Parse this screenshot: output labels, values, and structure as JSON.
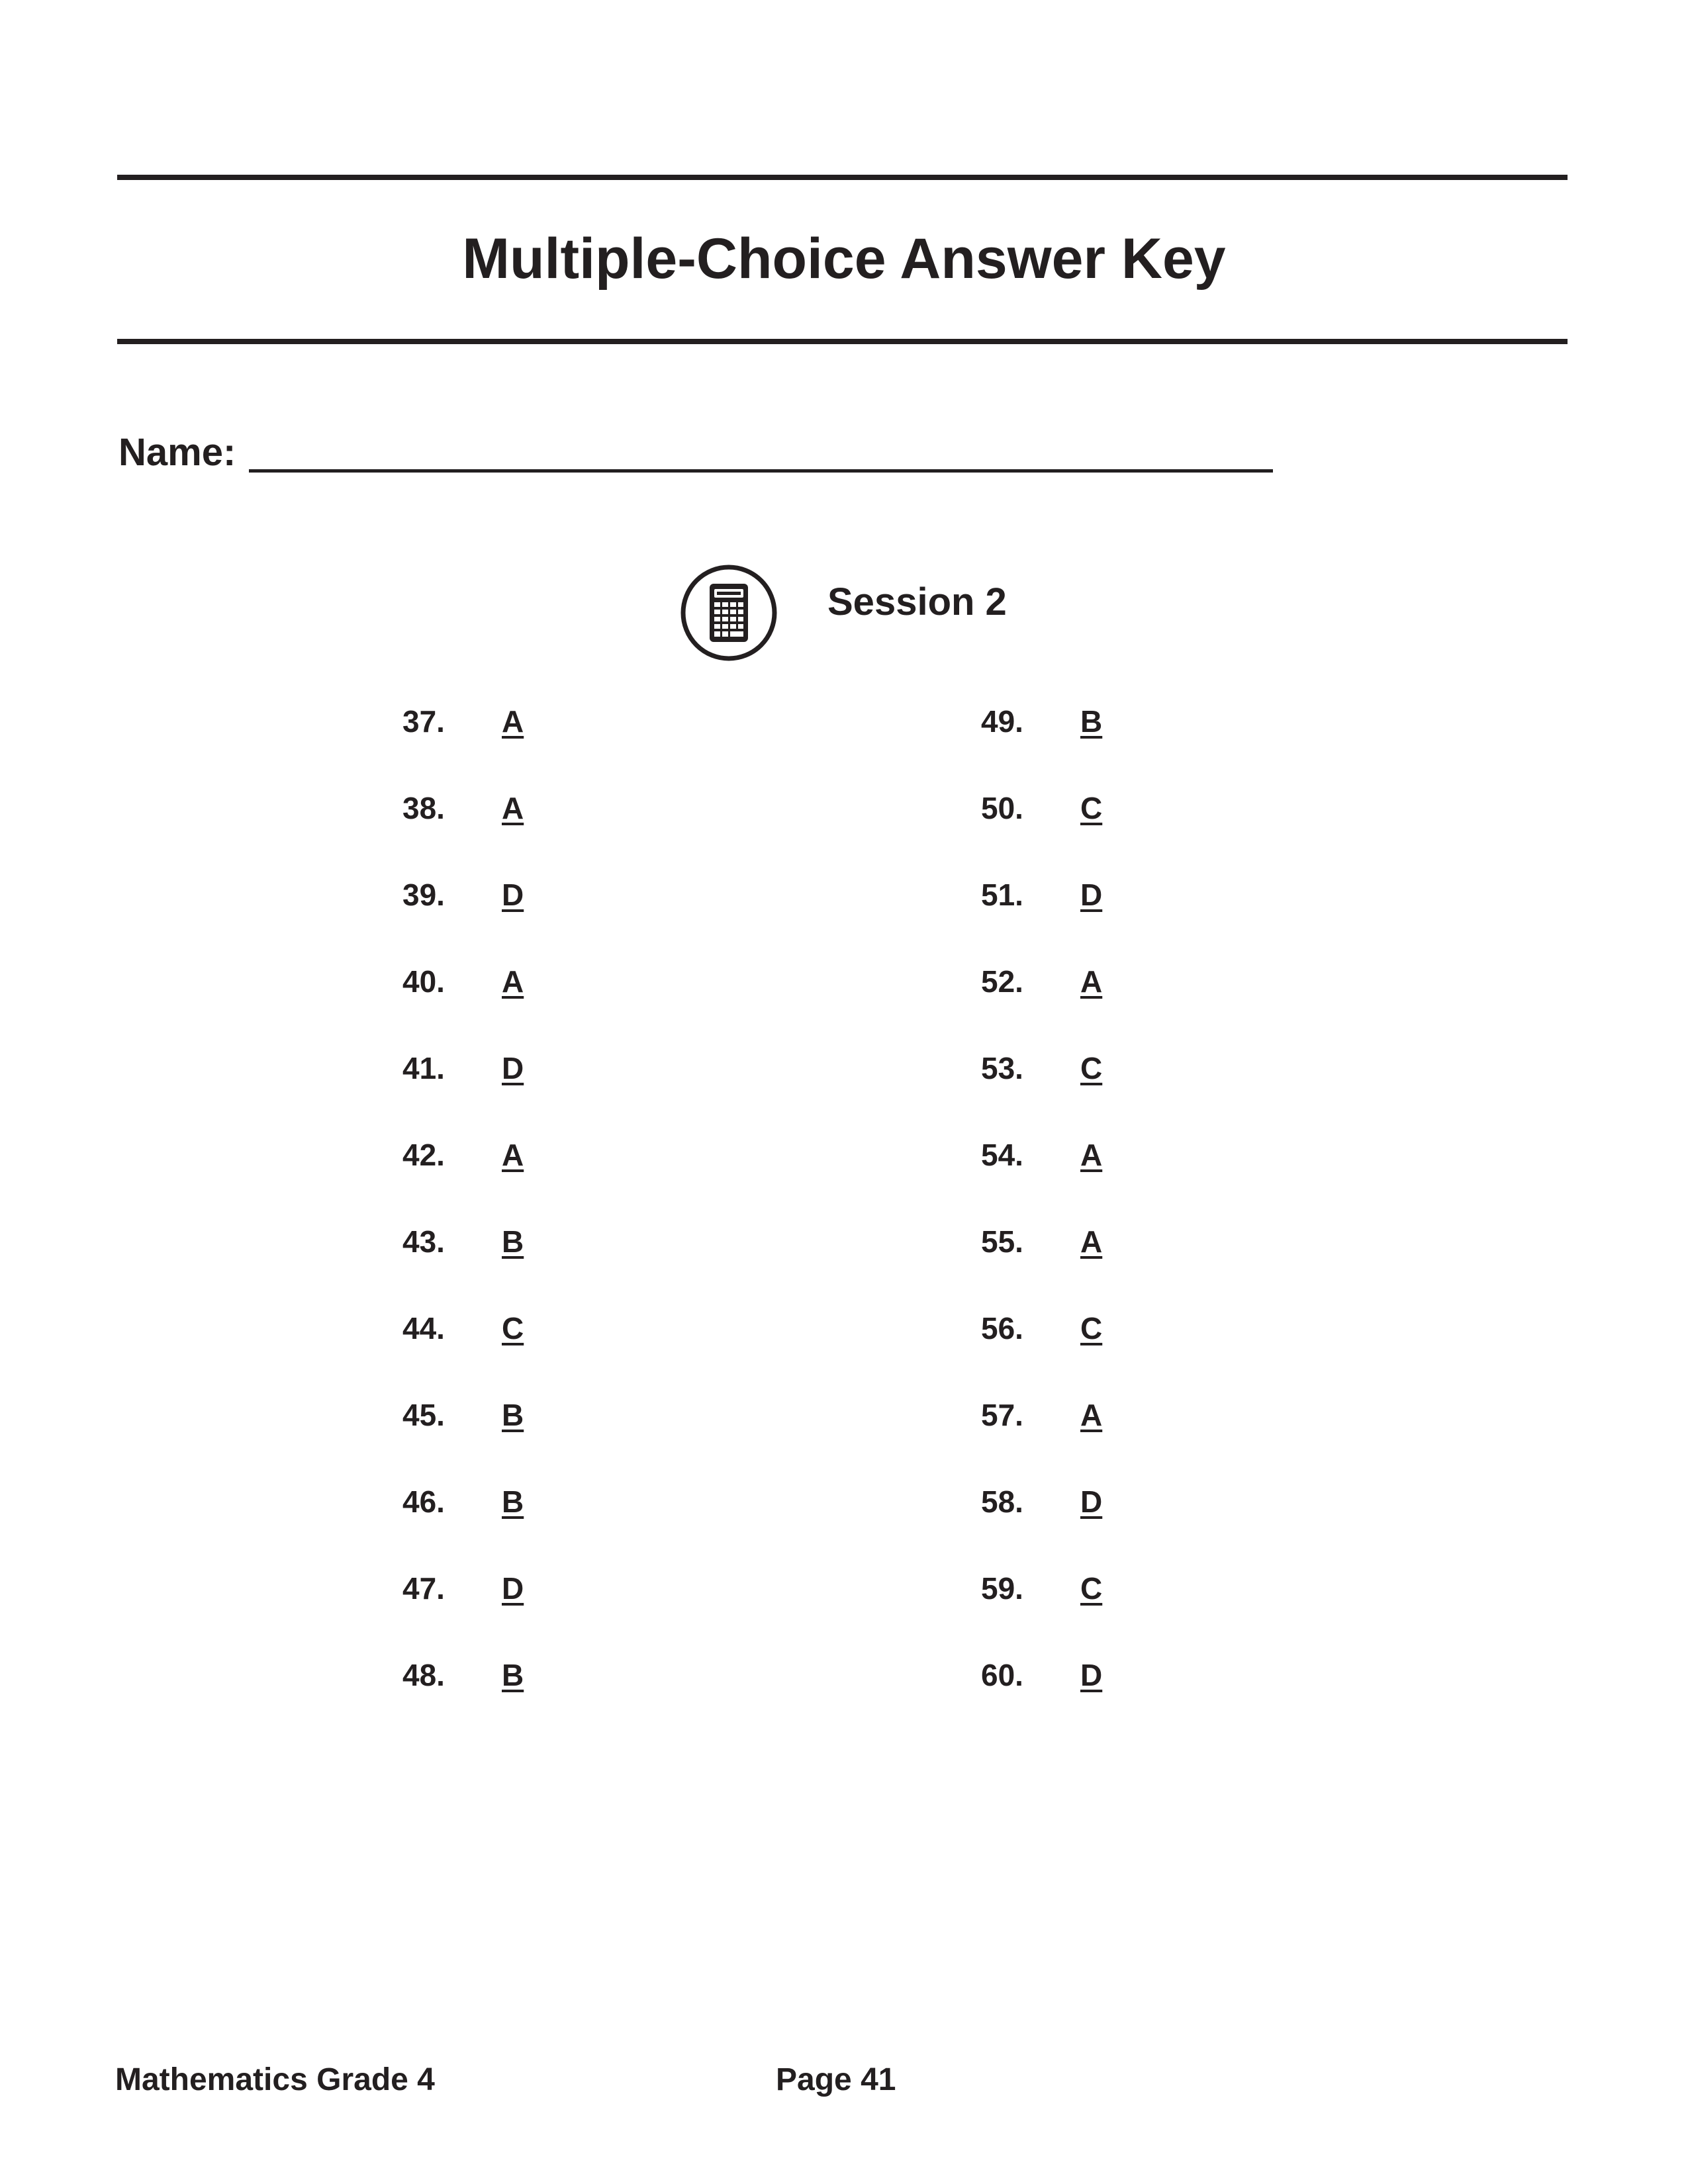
{
  "header": {
    "title": "Multiple-Choice Answer Key"
  },
  "name_field": {
    "label": "Name:"
  },
  "session": {
    "icon": "calculator-icon",
    "title": "Session 2"
  },
  "answers": {
    "left": [
      {
        "number": "37.",
        "answer": "A"
      },
      {
        "number": "38.",
        "answer": "A"
      },
      {
        "number": "39.",
        "answer": "D"
      },
      {
        "number": "40.",
        "answer": "A"
      },
      {
        "number": "41.",
        "answer": "D"
      },
      {
        "number": "42.",
        "answer": "A"
      },
      {
        "number": "43.",
        "answer": "B"
      },
      {
        "number": "44.",
        "answer": "C"
      },
      {
        "number": "45.",
        "answer": "B"
      },
      {
        "number": "46.",
        "answer": "B"
      },
      {
        "number": "47.",
        "answer": "D"
      },
      {
        "number": "48.",
        "answer": "B"
      }
    ],
    "right": [
      {
        "number": "49.",
        "answer": "B"
      },
      {
        "number": "50.",
        "answer": "C"
      },
      {
        "number": "51.",
        "answer": "D"
      },
      {
        "number": "52.",
        "answer": "A"
      },
      {
        "number": "53.",
        "answer": "C"
      },
      {
        "number": "54.",
        "answer": "A"
      },
      {
        "number": "55.",
        "answer": "A"
      },
      {
        "number": "56.",
        "answer": "C"
      },
      {
        "number": "57.",
        "answer": "A"
      },
      {
        "number": "58.",
        "answer": "D"
      },
      {
        "number": "59.",
        "answer": "C"
      },
      {
        "number": "60.",
        "answer": "D"
      }
    ]
  },
  "footer": {
    "subject": "Mathematics Grade 4",
    "page": "Page 41"
  },
  "colors": {
    "ink": "#231f20",
    "background": "#ffffff"
  }
}
